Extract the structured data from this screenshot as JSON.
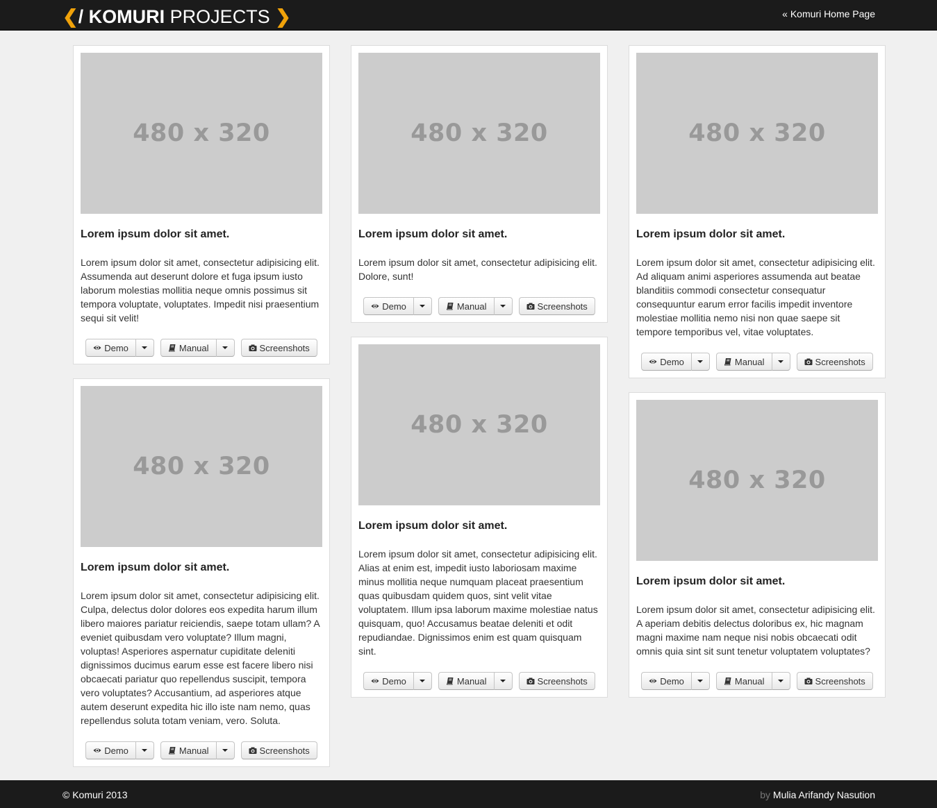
{
  "header": {
    "brand_open": "❮",
    "brand_slash": "/",
    "brand_bold": "KOMURI",
    "brand_light": "PROJECTS",
    "brand_close": "❯",
    "home_link": "« Komuri Home Page",
    "accent_color": "#f0a20a"
  },
  "buttons": {
    "demo": "Demo",
    "manual": "Manual",
    "screenshots": "Screenshots"
  },
  "cards": [
    {
      "placeholder": "480 x 320",
      "title": "Lorem ipsum dolor sit amet.",
      "text": "Lorem ipsum dolor sit amet, consectetur adipisicing elit. Assumenda aut deserunt dolore et fuga ipsum iusto laborum molestias mollitia neque omnis possimus sit tempora voluptate, voluptates. Impedit nisi praesentium sequi sit velit!"
    },
    {
      "placeholder": "480 x 320",
      "title": "Lorem ipsum dolor sit amet.",
      "text": "Lorem ipsum dolor sit amet, consectetur adipisicing elit. Culpa, delectus dolor dolores eos expedita harum illum libero maiores pariatur reiciendis, saepe totam ullam? A eveniet quibusdam vero voluptate? Illum magni, voluptas! Asperiores aspernatur cupiditate deleniti dignissimos ducimus earum esse est facere libero nisi obcaecati pariatur quo repellendus suscipit, tempora vero voluptates? Accusantium, ad asperiores atque autem deserunt expedita hic illo iste nam nemo, quas repellendus soluta totam veniam, vero. Soluta."
    },
    {
      "placeholder": "480 x 320",
      "title": "Lorem ipsum dolor sit amet.",
      "text": "Lorem ipsum dolor sit amet, consectetur adipisicing elit. Dolore, sunt!"
    },
    {
      "placeholder": "480 x 320",
      "title": "Lorem ipsum dolor sit amet.",
      "text": "Lorem ipsum dolor sit amet, consectetur adipisicing elit. Alias at enim est, impedit iusto laboriosam maxime minus mollitia neque numquam placeat praesentium quas quibusdam quidem quos, sint velit vitae voluptatem. Illum ipsa laborum maxime molestiae natus quisquam, quo! Accusamus beatae deleniti et odit repudiandae. Dignissimos enim est quam quisquam sint."
    },
    {
      "placeholder": "480 x 320",
      "title": "Lorem ipsum dolor sit amet.",
      "text": "Lorem ipsum dolor sit amet, consectetur adipisicing elit. Ad aliquam animi asperiores assumenda aut beatae blanditiis commodi consectetur consequatur consequuntur earum error facilis impedit inventore molestiae mollitia nemo nisi non quae saepe sit tempore temporibus vel, vitae voluptates."
    },
    {
      "placeholder": "480 x 320",
      "title": "Lorem ipsum dolor sit amet.",
      "text": "Lorem ipsum dolor sit amet, consectetur adipisicing elit. A aperiam debitis delectus doloribus ex, hic magnam magni maxime nam neque nisi nobis obcaecati odit omnis quia sint sit sunt tenetur voluptatem voluptates?"
    }
  ],
  "footer": {
    "copyright": "© Komuri 2013",
    "by": "by",
    "author": "Mulia Arifandy Nasution"
  }
}
